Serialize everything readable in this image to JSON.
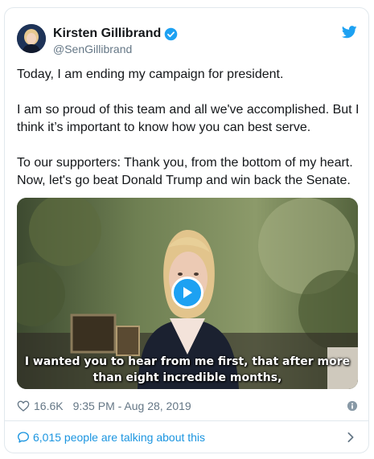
{
  "tweet": {
    "author": {
      "name": "Kirsten Gillibrand",
      "handle": "@SenGillibrand"
    },
    "text": {
      "paragraph1": "Today, I am ending my campaign for president.",
      "paragraph2": "I am so proud of this team and all we've accomplished. But I think it’s important to know how you can best serve.",
      "paragraph3": "To our supporters: Thank you, from the bottom of my heart. Now, let's go beat Donald Trump and win back the Senate."
    },
    "media": {
      "type": "video",
      "caption_line1": "I wanted you to hear from me first, that after more",
      "caption_line2": "than eight incredible months,"
    },
    "meta": {
      "likes": "16.6K",
      "timestamp": "9:35 PM - Aug 28, 2019"
    },
    "footer": {
      "talking": "6,015 people are talking about this"
    }
  },
  "colors": {
    "accent": "#1da1f2",
    "link": "#1b95e0",
    "muted": "#657786",
    "text": "#14171a",
    "border": "#e1e8ed"
  },
  "icons": [
    "verified-badge-icon",
    "twitter-bird-icon",
    "play-icon",
    "heart-icon",
    "info-icon",
    "speech-bubble-icon",
    "chevron-right-icon"
  ]
}
